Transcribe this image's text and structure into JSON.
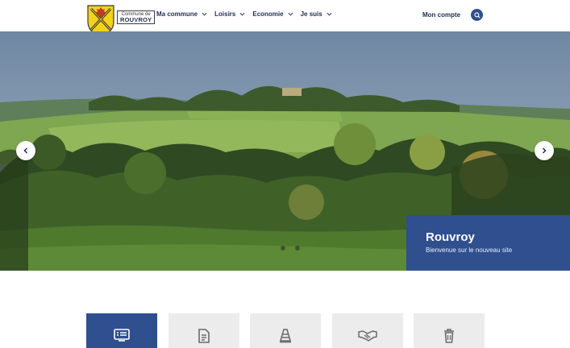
{
  "logo": {
    "line1": "Commune de",
    "line2": "ROUVROY",
    "icon": "coat-of-arms-icon"
  },
  "nav": {
    "items": [
      {
        "label": "Ma commune",
        "icon": "chevron-down-icon"
      },
      {
        "label": "Loisirs",
        "icon": "chevron-down-icon"
      },
      {
        "label": "Economie",
        "icon": "chevron-down-icon"
      },
      {
        "label": "Je suis",
        "icon": "chevron-down-icon"
      }
    ],
    "account_label": "Mon compte",
    "search_icon": "search-icon"
  },
  "hero": {
    "title": "Rouvroy",
    "subtitle": "Bienvenue sur le nouveau site",
    "prev_icon": "chevron-left-icon",
    "next_icon": "chevron-right-icon",
    "slide_count": 2,
    "active_slide": 1
  },
  "tiles": [
    {
      "icon": "news-list-icon",
      "active": true
    },
    {
      "icon": "document-icon",
      "active": false
    },
    {
      "icon": "traffic-cone-icon",
      "active": false
    },
    {
      "icon": "handshake-icon",
      "active": false
    },
    {
      "icon": "trash-bin-icon",
      "active": false
    }
  ],
  "colors": {
    "primary": "#2f4f8f",
    "tile_bg": "#ececec",
    "shield_yellow": "#f2d21b",
    "text": "#1f2e52"
  }
}
